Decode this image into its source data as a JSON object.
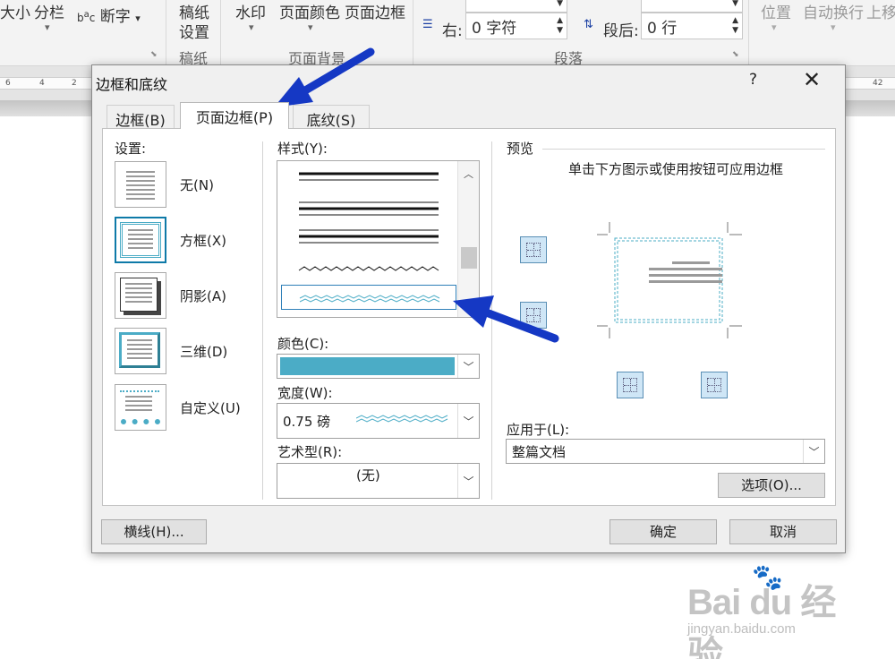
{
  "ribbon": {
    "size_label": "大小",
    "columns_label": "分栏",
    "hyphenation_label": "断字",
    "manuscript_label_1": "稿纸",
    "manuscript_label_2": "设置",
    "manuscript_group": "稿纸",
    "watermark_label": "水印",
    "page_color_label": "页面颜色",
    "page_borders_label": "页面边框",
    "page_background_group": "页面背景",
    "right_indent_label": "右:",
    "right_indent_value": "0 字符",
    "space_after_label": "段后:",
    "space_after_value": "0 行",
    "paragraph_group": "段落",
    "position_label": "位置",
    "wrap_text_label": "自动换行",
    "bring_forward_label": "上移"
  },
  "ruler": {
    "ticks_left": [
      "6",
      "4",
      "2"
    ],
    "ticks_right": [
      "42"
    ]
  },
  "dialog": {
    "title": "边框和底纹",
    "help": "?",
    "close": "✕",
    "tabs": [
      {
        "label": "边框(B)"
      },
      {
        "label": "页面边框(P)"
      },
      {
        "label": "底纹(S)"
      }
    ],
    "setting": {
      "label": "设置:",
      "items": [
        {
          "label": "无(N)"
        },
        {
          "label": "方框(X)"
        },
        {
          "label": "阴影(A)"
        },
        {
          "label": "三维(D)"
        },
        {
          "label": "自定义(U)"
        }
      ]
    },
    "style": {
      "label": "样式(Y):",
      "color_label": "颜色(C):",
      "color_value": "#4bacc6",
      "width_label": "宽度(W):",
      "width_value": "0.75 磅",
      "art_label": "艺术型(R):",
      "art_value": "(无)"
    },
    "preview": {
      "label": "预览",
      "hint": "单击下方图示或使用按钮可应用边框",
      "apply_to_label": "应用于(L):",
      "apply_to_value": "整篇文档",
      "options_button": "选项(O)..."
    },
    "footer": {
      "horizontal_line_button": "横线(H)...",
      "ok_button": "确定",
      "cancel_button": "取消"
    }
  },
  "watermark": {
    "logo": "Bai du 经验",
    "url": "jingyan.baidu.com"
  },
  "colors": {
    "accent_teal": "#4bacc6",
    "arrow_blue": "#1538c4"
  },
  "icons": [
    "dropdown-arrow-icon",
    "spin-up-down-icon",
    "close-icon",
    "help-icon",
    "border-apply-icon",
    "scroll-up-icon"
  ]
}
